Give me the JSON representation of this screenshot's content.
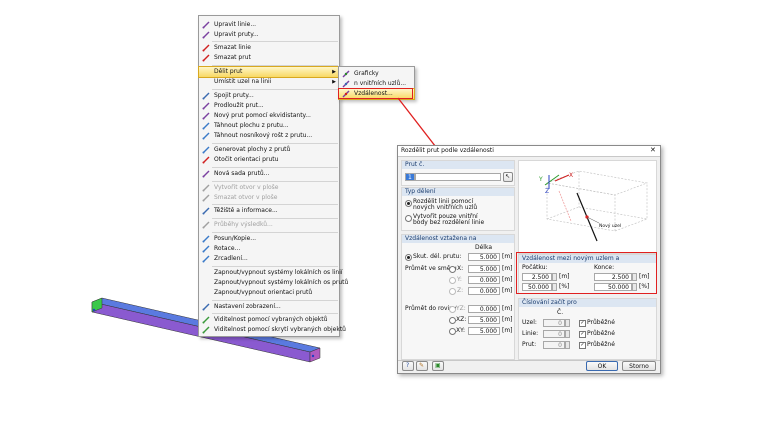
{
  "menu": {
    "items": [
      {
        "label": "Upravit linie...",
        "icon": "edit-line-icon",
        "color": "#7a3fa0",
        "disabled": false
      },
      {
        "label": "Upravit pruty...",
        "icon": "edit-member-icon",
        "color": "#7a3fa0",
        "disabled": false
      },
      {
        "label": "Smazat linie",
        "icon": "delete-line-icon",
        "color": "#d02020",
        "disabled": false
      },
      {
        "label": "Smazat prut",
        "icon": "delete-member-icon",
        "color": "#d02020",
        "disabled": false
      },
      {
        "label": "Dělit prut",
        "icon": "",
        "color": "",
        "disabled": false,
        "submenu": true,
        "highlighted": true
      },
      {
        "label": "Umístit uzel na linii",
        "icon": "",
        "color": "",
        "disabled": false,
        "submenu": true
      },
      {
        "label": "Spojit pruty...",
        "icon": "connect-members-icon",
        "color": "#3a6ab0",
        "disabled": false
      },
      {
        "label": "Prodloužit prut...",
        "icon": "extend-member-icon",
        "color": "#7a3fa0",
        "disabled": false
      },
      {
        "label": "Nový prut pomocí ekvidistanty...",
        "icon": "equidistant-icon",
        "color": "#7a3fa0",
        "disabled": false
      },
      {
        "label": "Táhnout plochu z prutu...",
        "icon": "extrude-surface-icon",
        "color": "#3a7ac8",
        "disabled": false
      },
      {
        "label": "Táhnout nosníkový rošt z prutu...",
        "icon": "extrude-grid-icon",
        "color": "#3a7ac8",
        "disabled": false
      },
      {
        "label": "Generovat plochy z prutů",
        "icon": "generate-surfaces-icon",
        "color": "#3a7ac8",
        "disabled": false
      },
      {
        "label": "Otočit orientaci prutu",
        "icon": "flip-orientation-icon",
        "color": "#d02020",
        "disabled": false
      },
      {
        "label": "Nová sada prutů...",
        "icon": "member-set-icon",
        "color": "#7a3fa0",
        "disabled": false
      },
      {
        "label": "Vytvořit otvor v ploše",
        "icon": "opening-icon",
        "color": "#a0a0a0",
        "disabled": true
      },
      {
        "label": "Smazat otvor v ploše",
        "icon": "delete-opening-icon",
        "color": "#a0a0a0",
        "disabled": true
      },
      {
        "label": "Těžiště a informace...",
        "icon": "centroid-icon",
        "color": "#3a6ab0",
        "disabled": false
      },
      {
        "label": "Průběhy výsledků...",
        "icon": "result-diagram-icon",
        "color": "#a0a0a0",
        "disabled": true
      },
      {
        "label": "Posun/Kopie...",
        "icon": "move-copy-icon",
        "color": "#3a7ac8",
        "disabled": false
      },
      {
        "label": "Rotace...",
        "icon": "rotate-icon",
        "color": "#3a7ac8",
        "disabled": false
      },
      {
        "label": "Zrcadlení...",
        "icon": "mirror-icon",
        "color": "#3a7ac8",
        "disabled": false
      },
      {
        "label": "Zapnout/vypnout systémy lokálních os linií",
        "icon": "",
        "color": "",
        "disabled": false
      },
      {
        "label": "Zapnout/vypnout systémy lokálních os prutů",
        "icon": "",
        "color": "",
        "disabled": false
      },
      {
        "label": "Zapnout/vypnout orientaci prutů",
        "icon": "",
        "color": "",
        "disabled": false
      },
      {
        "label": "Nastavení zobrazení...",
        "icon": "display-settings-icon",
        "color": "#3a6ab0",
        "disabled": false
      },
      {
        "label": "Viditelnost pomocí vybraných objektů",
        "icon": "visibility-selected-icon",
        "color": "#3a9a3a",
        "disabled": false
      },
      {
        "label": "Viditelnost pomocí skrytí vybraných objektů",
        "icon": "visibility-hide-icon",
        "color": "#3a9a3a",
        "disabled": false
      }
    ]
  },
  "submenu": {
    "items": [
      {
        "label": "Graficky",
        "icon": "graphic-divide-icon"
      },
      {
        "label": "n vnitřních uzlů...",
        "icon": "n-nodes-icon"
      },
      {
        "label": "Vzdálenost...",
        "icon": "distance-icon",
        "highlighted": true
      }
    ]
  },
  "dialog": {
    "title": "Rozdělit prut podle vzdálenosti",
    "member_group": "Prut č.",
    "member_value": "1",
    "division_group": "Typ dělení",
    "division_option1": "Rozdělit linii pomocí nových vnitřních uzlů",
    "division_option2": "Vytvořit pouze vnitřní body bez rozdělení linie",
    "ref_group": "Vzdálenost vztažena na",
    "col_length": "Délka",
    "opt_true_length": "Skut. dél. prutu:",
    "true_length_value": "5.000",
    "unit_m": "[m]",
    "unit_pct": "[%]",
    "projection_dir": "Průmět ve směru",
    "proj_x": "X:",
    "proj_y": "Y:",
    "proj_z": "Z:",
    "proj_x_value": "5.000",
    "proj_y_value": "0.000",
    "proj_z_value": "0.000",
    "projection_plane": "Průmět do roviny",
    "plane_yz": "YZ:",
    "plane_xz": "XZ:",
    "plane_xy": "XY:",
    "plane_yz_value": "0.000",
    "plane_xz_value": "5.000",
    "plane_xy_value": "5.000",
    "dist_group": "Vzdálenost mezi novým uzlem a",
    "start_label": "Počátku:",
    "end_label": "Konce:",
    "start_m": "2.500",
    "start_pct": "50.000",
    "end_m": "2.500",
    "end_pct": "50.000",
    "numbering_group": "Číslování začít pro",
    "col_no": "Č.",
    "node_label": "Uzel:",
    "line_label": "Linie:",
    "member_label": "Prut:",
    "node_no": "0",
    "line_no": "0",
    "member_no": "0",
    "running_label": "Průběžné",
    "preview_new_node": "Nový uzel",
    "axis_x": "X",
    "axis_y": "Y",
    "axis_z": "Z",
    "ok_label": "OK",
    "cancel_label": "Storno"
  },
  "colors": {
    "highlight": "#f8d864",
    "red_annotation": "#e02020",
    "group_header": "#dce6f2",
    "beam": "#7a6ad8"
  }
}
